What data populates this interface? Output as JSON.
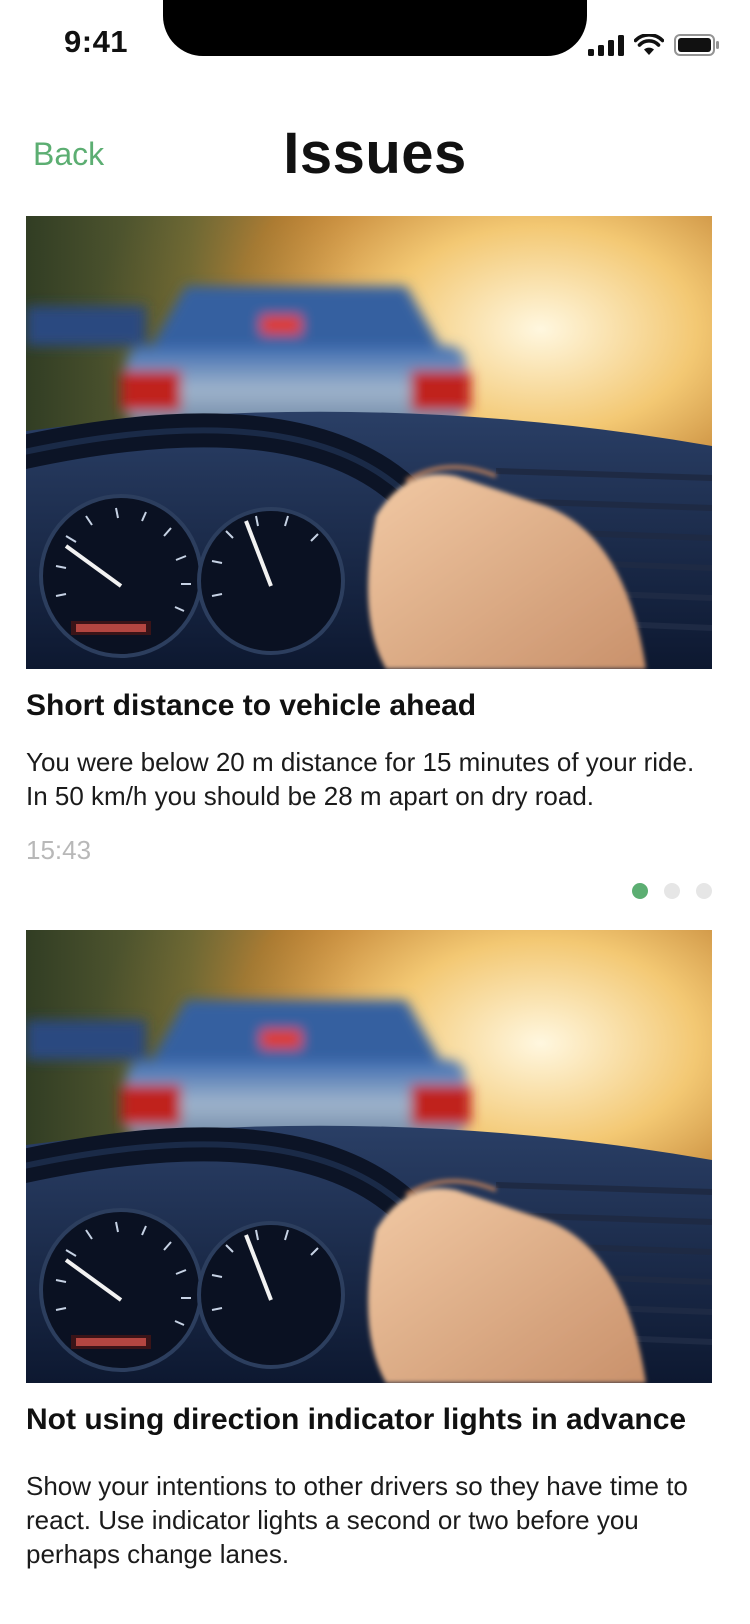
{
  "status_bar": {
    "time": "9:41",
    "icons": [
      "cellular-signal-icon",
      "wifi-icon",
      "battery-icon"
    ]
  },
  "nav": {
    "back_label": "Back",
    "title": "Issues"
  },
  "colors": {
    "accent": "#5cae72",
    "timestamp": "#b8b8b8",
    "dot_inactive": "#e6e6e6"
  },
  "issues": [
    {
      "title": "Short distance to vehicle ahead",
      "description": "You were below 20 m distance for 15 minutes of your ride. In 50 km/h you should be 28 m apart on dry road.",
      "time": "15:43",
      "image": "dashboard-driving-photo",
      "pager": {
        "pages": 3,
        "active": 1
      }
    },
    {
      "title": "Not using direction indicator lights in advance",
      "description": "Show your intentions to other drivers so they have time to react. Use indicator lights a second or two before you perhaps change lanes.",
      "image": "dashboard-driving-photo"
    }
  ]
}
